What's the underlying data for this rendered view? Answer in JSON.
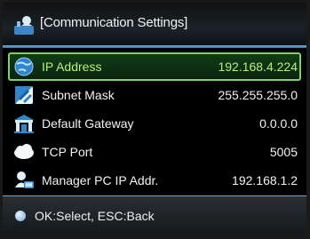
{
  "header": {
    "title": "[Communication Settings]",
    "icon": "settings-person-icon"
  },
  "menu": {
    "items": [
      {
        "icon": "globe-icon",
        "label": "IP Address",
        "value": "192.168.4.224",
        "selected": true
      },
      {
        "icon": "subnet-mask-icon",
        "label": "Subnet Mask",
        "value": "255.255.255.0",
        "selected": false
      },
      {
        "icon": "gateway-icon",
        "label": "Default Gateway",
        "value": "0.0.0.0",
        "selected": false
      },
      {
        "icon": "cloud-icon",
        "label": "TCP Port",
        "value": "5005",
        "selected": false
      },
      {
        "icon": "manager-pc-icon",
        "label": "Manager PC IP Addr.",
        "value": "192.168.1.2",
        "selected": false
      }
    ]
  },
  "footer": {
    "hint": "OK:Select, ESC:Back",
    "icon": "bullet-icon"
  },
  "colors": {
    "selected_text": "#b5f07a",
    "selected_border": "#83d06a",
    "divider": "#5a9bd0",
    "text": "#f2f2f2"
  }
}
